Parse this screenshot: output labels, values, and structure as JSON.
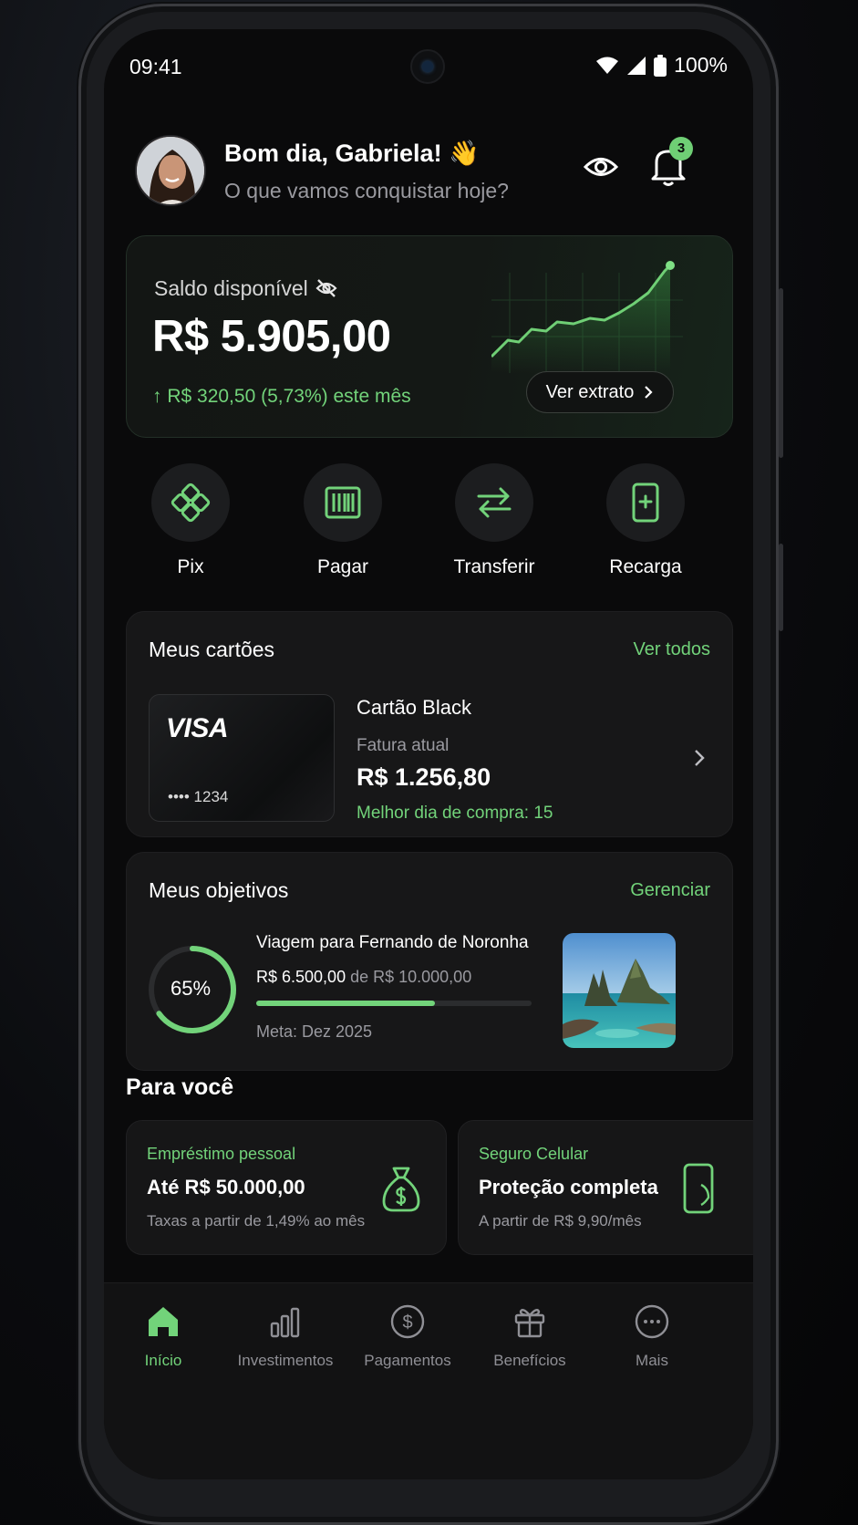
{
  "status_bar": {
    "time": "09:41",
    "battery": "100%"
  },
  "header": {
    "greeting": "Bom dia, Gabriela! 👋",
    "subtitle": "O que vamos conquistar hoje?",
    "notification_count": "3"
  },
  "balance": {
    "label": "Saldo disponível",
    "value": "R$ 5.905,00",
    "change": "↑ R$ 320,50 (5,73%) este mês",
    "statement_button": "Ver extrato"
  },
  "quick_actions": [
    {
      "label": "Pix",
      "icon": "pix-icon"
    },
    {
      "label": "Pagar",
      "icon": "barcode-icon"
    },
    {
      "label": "Transferir",
      "icon": "transfer-icon"
    },
    {
      "label": "Recarga",
      "icon": "phone-recharge-icon"
    }
  ],
  "cards": {
    "title": "Meus cartões",
    "link": "Ver todos",
    "card": {
      "brand": "VISA",
      "number": "•••• 1234",
      "name": "Cartão Black",
      "invoice_label": "Fatura atual",
      "invoice_amount": "R$ 1.256,80",
      "best_day": "Melhor dia de compra: 15"
    }
  },
  "goals": {
    "title": "Meus objetivos",
    "link": "Gerenciar",
    "goal": {
      "percent_label": "65%",
      "progress": 0.65,
      "name": "Viagem para Fernando de Noronha",
      "saved": "R$ 6.500,00",
      "target": "de R$ 10.000,00",
      "deadline": "Meta: Dez 2025"
    }
  },
  "for_you": {
    "title": "Para você",
    "offers": [
      {
        "tag": "Empréstimo pessoal",
        "title": "Até R$ 50.000,00",
        "subtitle": "Taxas a partir de 1,49% ao mês",
        "icon": "money-bag-icon"
      },
      {
        "tag": "Seguro Celular",
        "title": "Proteção completa",
        "subtitle": "A partir de R$ 9,90/mês",
        "icon": "phone-shield-icon"
      }
    ]
  },
  "tab_bar": [
    {
      "label": "Início",
      "icon": "home-icon",
      "active": true
    },
    {
      "label": "Investimentos",
      "icon": "bar-chart-icon",
      "active": false
    },
    {
      "label": "Pagamentos",
      "icon": "dollar-circle-icon",
      "active": false
    },
    {
      "label": "Benefícios",
      "icon": "gift-icon",
      "active": false
    },
    {
      "label": "Mais",
      "icon": "more-icon",
      "active": false
    }
  ],
  "colors": {
    "accent": "#72d37a",
    "background": "#0a0a0b",
    "surface": "#171718"
  }
}
